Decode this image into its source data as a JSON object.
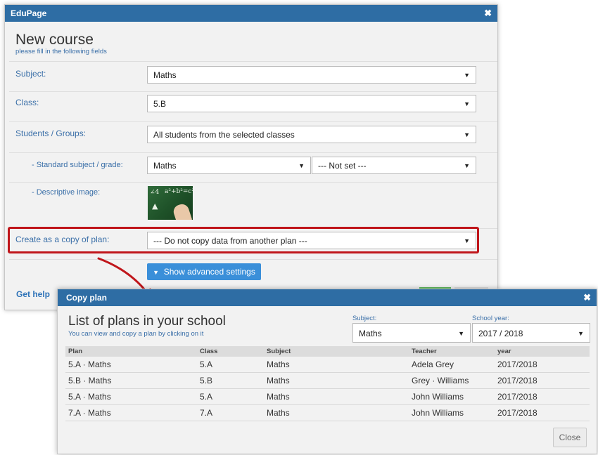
{
  "new_course": {
    "window_title": "EduPage",
    "title": "New course",
    "subtitle": "please fill in the following fields",
    "fields": {
      "subject": {
        "label": "Subject:",
        "value": "Maths"
      },
      "class": {
        "label": "Class:",
        "value": "5.B"
      },
      "students": {
        "label": "Students / Groups:",
        "value": "All students from the selected classes"
      },
      "standard": {
        "label": "- Standard subject / grade:",
        "value": "Maths",
        "grade_value": "--- Not set ---"
      },
      "image": {
        "label": "- Descriptive image:"
      },
      "copy_plan": {
        "label": "Create as a copy of plan:",
        "value": "--- Do not copy data from another plan ---"
      }
    },
    "advanced_button": "Show advanced settings",
    "get_help": "Get help",
    "close_glyph": "✖",
    "dropdown_glyph": "▼"
  },
  "copy_plan": {
    "window_title": "Copy plan",
    "title": "List of plans in your school",
    "subtitle": "You can view and copy a plan by clicking on it",
    "subject_filter": {
      "label": "Subject:",
      "value": "Maths"
    },
    "year_filter": {
      "label": "School year:",
      "value": "2017 / 2018"
    },
    "columns": [
      "Plan",
      "Class",
      "Subject",
      "Teacher",
      "year"
    ],
    "rows": [
      [
        "5.A · Maths",
        "5.A",
        "Maths",
        "Adela Grey",
        "2017/2018"
      ],
      [
        "5.B · Maths",
        "5.B",
        "Maths",
        "Grey · Williams",
        "2017/2018"
      ],
      [
        "5.A · Maths",
        "5.A",
        "Maths",
        "John Williams",
        "2017/2018"
      ],
      [
        "7.A · Maths",
        "7.A",
        "Maths",
        "John Williams",
        "2017/2018"
      ]
    ],
    "close_button": "Close"
  },
  "colors": {
    "title_bar": "#2e6da4",
    "highlight": "#c0161b",
    "accent_button": "#3a8fd9",
    "link": "#2e73b8"
  },
  "icons": {
    "close": "close-icon",
    "dropdown": "chevron-down-icon",
    "arrow": "callout-arrow"
  }
}
